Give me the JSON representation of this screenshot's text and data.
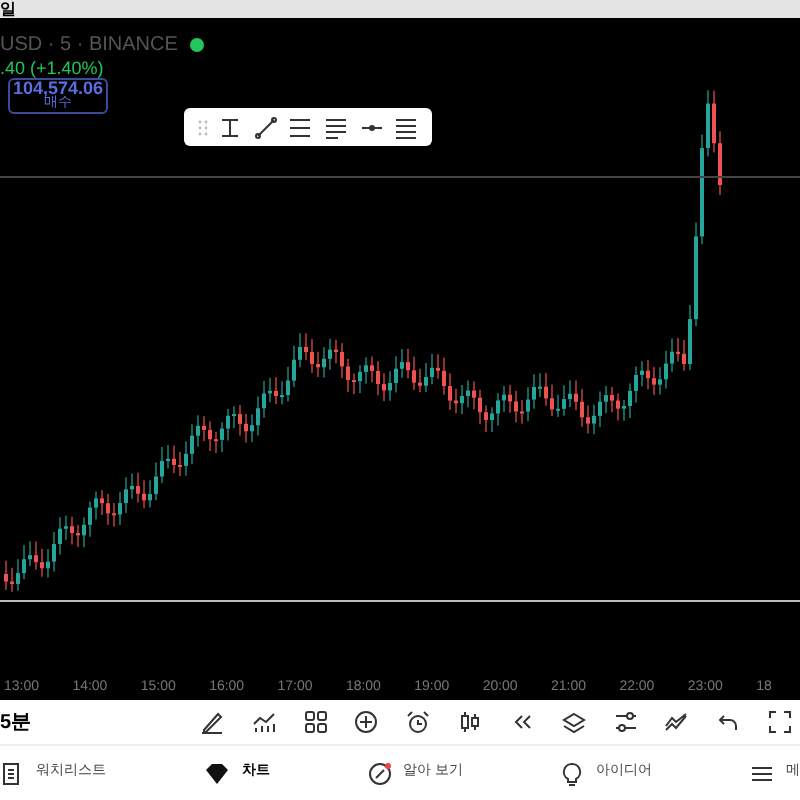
{
  "header": {
    "title": "일"
  },
  "symbol": {
    "name": "USD · 5 · BINANCE",
    "change": ".40 (+1.40%)",
    "price": "104,574.06",
    "action": "매수"
  },
  "time_axis": [
    "13:00",
    "14:00",
    "15:00",
    "16:00",
    "17:00",
    "18:00",
    "19:00",
    "20:00",
    "21:00",
    "22:00",
    "23:00",
    "18"
  ],
  "toolbar": {
    "interval": "5분"
  },
  "nav": [
    {
      "label": "워치리스트",
      "selected": false
    },
    {
      "label": "차트",
      "selected": true
    },
    {
      "label": "알아 보기",
      "selected": false
    },
    {
      "label": "아이디어",
      "selected": false
    },
    {
      "label": "메",
      "selected": false
    }
  ]
}
